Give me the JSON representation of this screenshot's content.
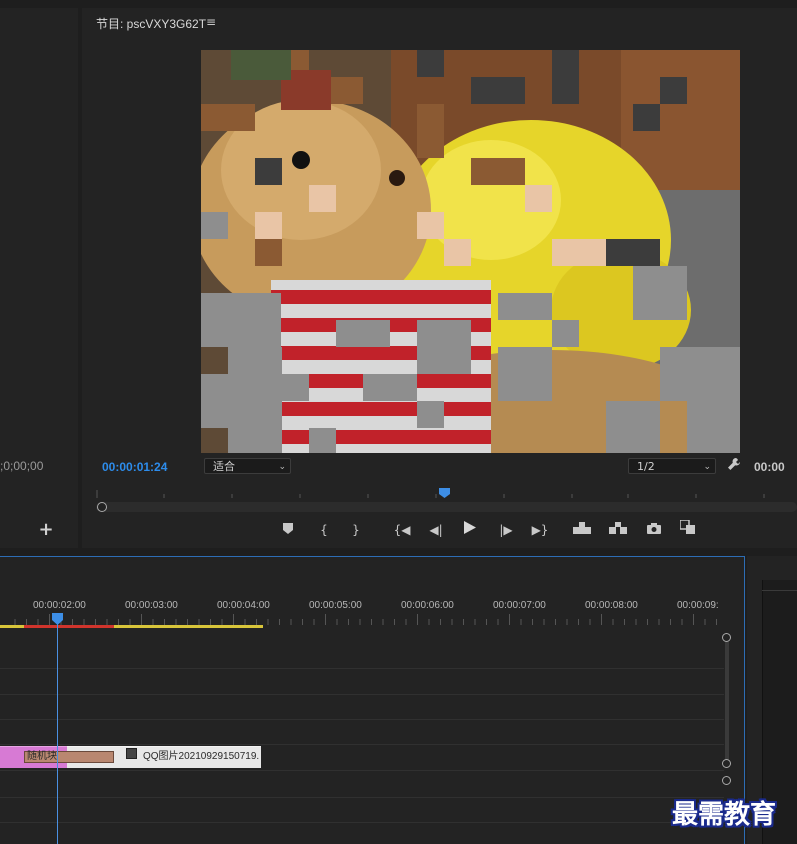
{
  "left_panel": {
    "timecode": ";0;00;00",
    "add_label": "+"
  },
  "program_monitor": {
    "title": "节目: pscVXY3G62T",
    "menu_icon": "hamburger-icon",
    "current_timecode": "00:00:01:24",
    "zoom_select": "适合",
    "resolution_select": "1/2",
    "duration_timecode": "00:00"
  },
  "transport": [
    {
      "name": "marker-icon"
    },
    {
      "name": "mark-in-icon"
    },
    {
      "name": "mark-out-icon"
    },
    {
      "name": "go-to-in-icon"
    },
    {
      "name": "step-back-icon"
    },
    {
      "name": "play-icon"
    },
    {
      "name": "step-forward-icon"
    },
    {
      "name": "go-to-out-icon"
    },
    {
      "name": "lift-icon"
    },
    {
      "name": "extract-icon"
    },
    {
      "name": "camera-icon"
    },
    {
      "name": "compare-icon"
    }
  ],
  "timeline": {
    "ruler_labels": [
      "00:00:02:00",
      "00:00:03:00",
      "00:00:04:00",
      "00:00:05:00",
      "00:00:06:00",
      "00:00:07:00",
      "00:00:08:00",
      "00:00:09:"
    ],
    "effect_label": "随机块",
    "clip_name": "QQ图片20210929150719."
  },
  "watermark": "最需教育",
  "colors": {
    "accent": "#2d8ceb",
    "clip_pink": "#d77ad4",
    "work_area": "#d8c53a",
    "render_red": "#d0342c"
  }
}
